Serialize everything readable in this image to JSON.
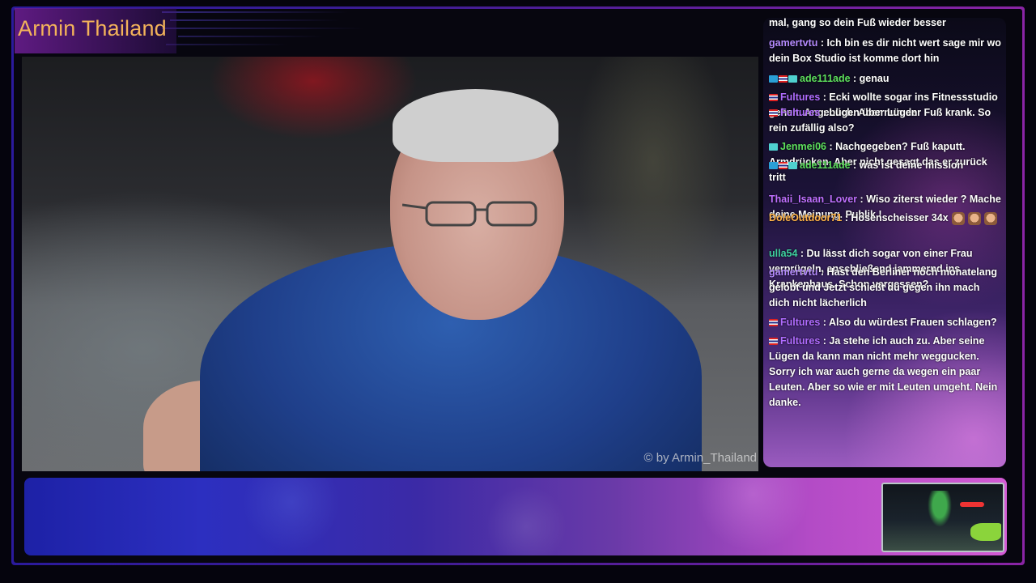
{
  "channel": {
    "title": "Armin Thailand"
  },
  "webcam": {
    "watermark": "© by Armin_Thailand"
  },
  "chat": {
    "top_partial": "mal, gang so dein Fuß wieder besser",
    "messages": [
      {
        "user": "gamertvtu",
        "user_color": "#b58bff",
        "badges": [],
        "text": "Ich bin es dir nicht wert sage mir wo dein Box Studio ist komme dort hin",
        "emotes": 0
      },
      {
        "user": "ade111ade",
        "user_color": "#5de05d",
        "badges": [
          "sub",
          "flag",
          "bits"
        ],
        "text": "genau",
        "emotes": 0
      },
      {
        "user": "Fultures",
        "user_color": "#b06cff",
        "badges": [
          "flag"
        ],
        "text": "Ecki wollte sogar ins Fitnessstudio gehen. Angeblich. Aber nun der Fuß krank. So rein zufällig also?",
        "emotes": 0
      },
      {
        "user": "Fultures",
        "user_color": "#b06cff",
        "badges": [
          "flag"
        ],
        "text": "Lügen über Lügen",
        "emotes": 0
      },
      {
        "user": "Jenmei06",
        "user_color": "#5de05d",
        "badges": [
          "bits"
        ],
        "text": "Nachgegeben? Fuß kaputt. Armdrücken. Aber nicht gesagt das er zurück tritt",
        "emotes": 0
      },
      {
        "user": "ade111ade",
        "user_color": "#5de05d",
        "badges": [
          "sub",
          "flag",
          "bits"
        ],
        "text": "was ist deine mission",
        "emotes": 0
      },
      {
        "user": "Thaii_Isaan_Lover",
        "user_color": "#c070ff",
        "badges": [],
        "text": "Wiso ziterst wieder ? Mache deine Meinung. Publik !",
        "emotes": 0
      },
      {
        "user": "DoleOutdoor71",
        "user_color": "#ffb347",
        "badges": [],
        "text": "Hosenscheisser 34x",
        "emotes": 3
      },
      {
        "user": "ulla54",
        "user_color": "#3ed1a0",
        "badges": [],
        "text": "Du lässt dich sogar von einer Frau verprügeln, anschließend jammernd ins Krankenhaus. Schon vergessen?",
        "emotes": 0
      },
      {
        "user": "gamertvtu",
        "user_color": "#b58bff",
        "badges": [],
        "text": "Hast den Berliner noch monatelang gelobt und Jetzt schießt du gegen ihn mach dich nicht lächerlich",
        "emotes": 0
      },
      {
        "user": "Fultures",
        "user_color": "#b06cff",
        "badges": [
          "flag"
        ],
        "text": "Also du würdest Frauen schlagen?",
        "emotes": 0
      },
      {
        "user": "Fultures",
        "user_color": "#b06cff",
        "badges": [
          "flag"
        ],
        "text": "Ja stehe ich auch zu. Aber seine Lügen da kann man nicht mehr weggucken. Sorry ich war auch gerne da wegen ein paar Leuten. Aber so wie er mit Leuten umgeht. Nein danke.",
        "emotes": 0
      }
    ]
  },
  "colors": {
    "title": "#f3b35a",
    "frame_left": "#2b1a9c",
    "frame_right": "#8a24a5"
  }
}
